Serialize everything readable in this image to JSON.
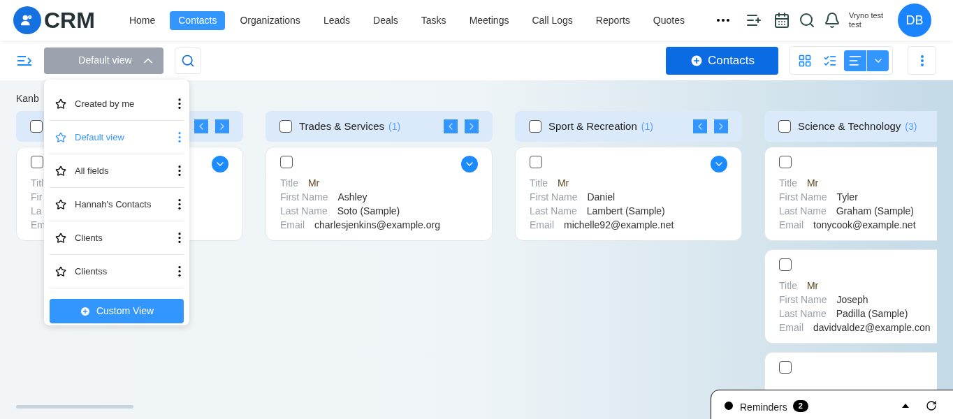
{
  "logo": {
    "text": "CRM"
  },
  "nav": [
    {
      "label": "Home",
      "selected": false
    },
    {
      "label": "Contacts",
      "selected": true
    },
    {
      "label": "Organizations",
      "selected": false
    },
    {
      "label": "Leads",
      "selected": false
    },
    {
      "label": "Deals",
      "selected": false
    },
    {
      "label": "Tasks",
      "selected": false
    },
    {
      "label": "Meetings",
      "selected": false
    },
    {
      "label": "Call Logs",
      "selected": false
    },
    {
      "label": "Reports",
      "selected": false
    },
    {
      "label": "Quotes",
      "selected": false
    }
  ],
  "user": {
    "name": "Vryno test test",
    "avatar": "DB"
  },
  "toolbar": {
    "view_select": "Default view",
    "expanded": true,
    "add_button": "Contacts",
    "view_modes": [
      {
        "kind": "grid",
        "selected": false
      },
      {
        "kind": "list",
        "selected": false
      },
      {
        "kind": "kanban",
        "selected": true
      }
    ]
  },
  "view_menu": {
    "items": [
      {
        "label": "Created by me",
        "selected": false
      },
      {
        "label": "Default view",
        "selected": true
      },
      {
        "label": "All fields",
        "selected": false
      },
      {
        "label": "Hannah's Contacts",
        "selected": false
      },
      {
        "label": "Clients",
        "selected": false
      },
      {
        "label": "Clientss",
        "selected": false
      }
    ],
    "button": "Custom View"
  },
  "board": {
    "title": "Kanb",
    "columns": [
      {
        "checked": false,
        "cards": [
          {
            "checked": false,
            "fields": [
              {
                "label": "Titl"
              },
              {
                "label": "Fir"
              },
              {
                "label": "La"
              },
              {
                "label": "Em"
              }
            ]
          }
        ]
      },
      {
        "title": "Trades & Services",
        "count": "(1)",
        "checked": false,
        "cards": [
          {
            "checked": false,
            "fields": [
              {
                "label": "Title",
                "value": "Mr"
              },
              {
                "label": "First Name",
                "value": "Ashley"
              },
              {
                "label": "Last Name",
                "value": "Soto (Sample)"
              },
              {
                "label": "Email",
                "value": "charlesjenkins@example.org"
              }
            ]
          }
        ]
      },
      {
        "title": "Sport & Recreation",
        "count": "(1)",
        "checked": false,
        "cards": [
          {
            "checked": false,
            "fields": [
              {
                "label": "Title",
                "value": "Mr"
              },
              {
                "label": "First Name",
                "value": "Daniel"
              },
              {
                "label": "Last Name",
                "value": "Lambert (Sample)"
              },
              {
                "label": "Email",
                "value": "michelle92@example.net"
              }
            ]
          }
        ]
      },
      {
        "title": "Science & Technology",
        "count": "(3)",
        "checked": false,
        "cards": [
          {
            "checked": false,
            "fields": [
              {
                "label": "Title",
                "value": "Mr"
              },
              {
                "label": "First Name",
                "value": "Tyler"
              },
              {
                "label": "Last Name",
                "value": "Graham (Sample)"
              },
              {
                "label": "Email",
                "value": "tonycook@example.net"
              }
            ]
          },
          {
            "checked": false,
            "fields": [
              {
                "label": "Title",
                "value": "Mr"
              },
              {
                "label": "First Name",
                "value": "Joseph"
              },
              {
                "label": "Last Name",
                "value": "Padilla (Sample)"
              },
              {
                "label": "Email",
                "value": "davidvaldez@example.con"
              }
            ]
          },
          {
            "checked": false
          }
        ]
      }
    ]
  },
  "reminders": {
    "label": "Reminders",
    "count": "2"
  }
}
